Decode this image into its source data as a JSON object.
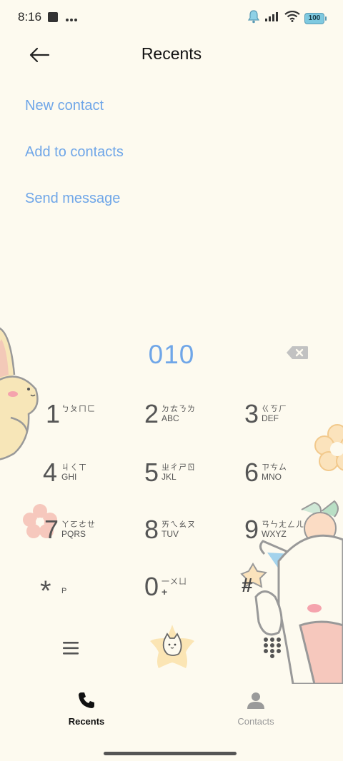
{
  "status_bar": {
    "time": "8:16",
    "battery": "100"
  },
  "header": {
    "title": "Recents"
  },
  "actions": {
    "new_contact": "New contact",
    "add_to_contacts": "Add to contacts",
    "send_message": "Send message"
  },
  "dialer": {
    "number": "010"
  },
  "keypad": {
    "keys": [
      {
        "digit": "1",
        "zhuyin": "ㄅㄆㄇㄈ",
        "letters": ""
      },
      {
        "digit": "2",
        "zhuyin": "ㄉㄊㄋㄌ",
        "letters": "ABC"
      },
      {
        "digit": "3",
        "zhuyin": "ㄍㄎㄏ",
        "letters": "DEF"
      },
      {
        "digit": "4",
        "zhuyin": "ㄐㄑㄒ",
        "letters": "GHI"
      },
      {
        "digit": "5",
        "zhuyin": "ㄓㄔㄕㄖ",
        "letters": "JKL"
      },
      {
        "digit": "6",
        "zhuyin": "ㄗㄘㄙ",
        "letters": "MNO"
      },
      {
        "digit": "7",
        "zhuyin": "ㄚㄛㄜㄝ",
        "letters": "PQRS"
      },
      {
        "digit": "8",
        "zhuyin": "ㄞㄟㄠㄡ",
        "letters": "TUV"
      },
      {
        "digit": "9",
        "zhuyin": "ㄢㄣㄤㄥㄦ",
        "letters": "WXYZ"
      },
      {
        "digit": "*",
        "zhuyin": "",
        "letters": "P"
      },
      {
        "digit": "0",
        "zhuyin": "一ㄨㄩ",
        "letters": "+"
      },
      {
        "digit": "#",
        "zhuyin": "",
        "letters": ""
      }
    ]
  },
  "tabs": {
    "recents": "Recents",
    "contacts": "Contacts"
  },
  "colors": {
    "background": "#fdfaef",
    "accent_blue": "#6fa6e8",
    "key_text": "#555555"
  }
}
